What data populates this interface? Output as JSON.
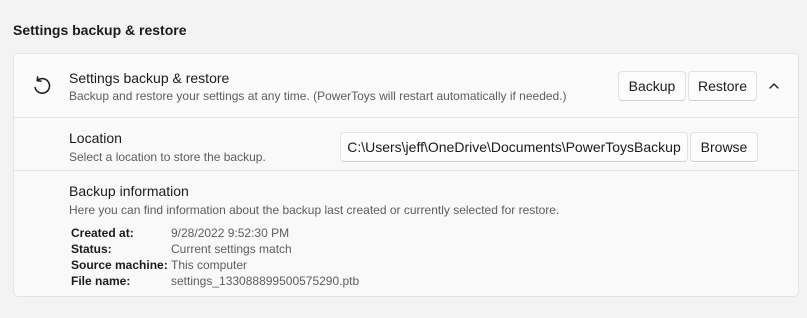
{
  "section_title": "Settings backup & restore",
  "header": {
    "icon": "restore-icon",
    "title": "Settings backup & restore",
    "description": "Backup and restore your settings at any time. (PowerToys will restart automatically if needed.)",
    "backup_label": "Backup",
    "restore_label": "Restore",
    "collapse_icon": "chevron-up-icon"
  },
  "location": {
    "title": "Location",
    "description": "Select a location to store the backup.",
    "path": "C:\\Users\\jeff\\OneDrive\\Documents\\PowerToysBackup",
    "browse_label": "Browse"
  },
  "backup_info": {
    "title": "Backup information",
    "description": "Here you can find information about the backup last created or currently selected for restore.",
    "details": [
      {
        "label": "Created at:",
        "value": "9/28/2022 9:52:30 PM"
      },
      {
        "label": "Status:",
        "value": "Current settings match"
      },
      {
        "label": "Source machine:",
        "value": "This computer"
      },
      {
        "label": "File name:",
        "value": "settings_133088899500575290.ptb"
      }
    ]
  },
  "colors": {
    "background": "#f3f3f3",
    "card": "#f9f9f9",
    "border": "#e5e5e5",
    "secondary_text": "#5d5d5d"
  }
}
